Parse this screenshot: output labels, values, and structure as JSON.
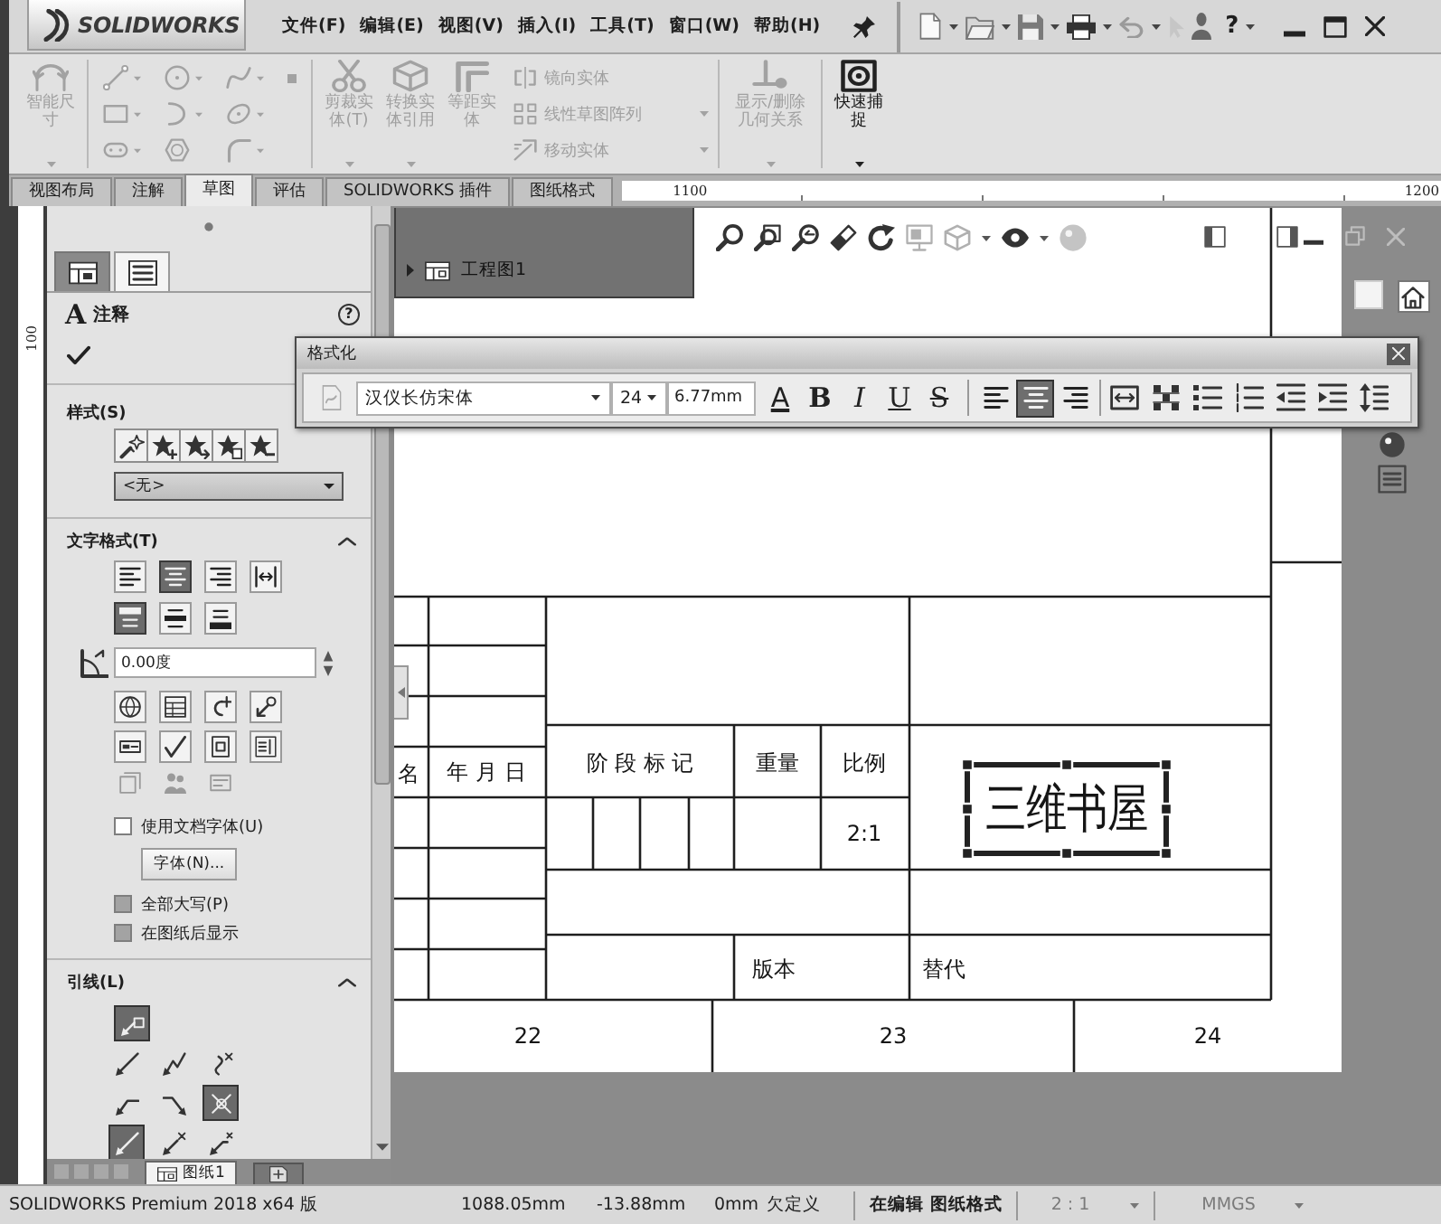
{
  "title_bar": {
    "logo": "SOLIDWORKS",
    "menus": [
      "文件(F)",
      "编辑(E)",
      "视图(V)",
      "插入(I)",
      "工具(T)",
      "窗口(W)",
      "帮助(H)"
    ],
    "help": "?"
  },
  "ribbon": {
    "groups": [
      {
        "items": [
          {
            "kind": "large",
            "label": "智能尺寸",
            "disabled": true,
            "dropdown": true
          }
        ]
      },
      {
        "items": [
          {
            "kind": "sketch_grid",
            "disabled": true
          }
        ]
      },
      {
        "items": [
          {
            "kind": "large",
            "label": "剪裁实体(T)",
            "disabled": true,
            "dropdown": true
          },
          {
            "kind": "large",
            "label": "转换实体引用",
            "disabled": true,
            "dropdown": true
          },
          {
            "kind": "large",
            "label": "等距实体",
            "disabled": true,
            "dropdown": false
          },
          {
            "kind": "stack",
            "entries": [
              {
                "label": "镜向实体",
                "disabled": true,
                "dropdown": false
              },
              {
                "label": "线性草图阵列",
                "disabled": true,
                "dropdown": true
              },
              {
                "label": "移动实体",
                "disabled": true,
                "dropdown": true
              }
            ]
          }
        ]
      },
      {
        "items": [
          {
            "kind": "large",
            "label": "显示/删除几何关系",
            "disabled": true,
            "dropdown": true
          }
        ]
      },
      {
        "items": [
          {
            "kind": "large",
            "label": "快速捕捉",
            "disabled": false,
            "dropdown": true
          }
        ]
      }
    ]
  },
  "command_tabs": [
    {
      "label": "视图布局",
      "selected": false
    },
    {
      "label": "注解",
      "selected": false
    },
    {
      "label": "草图",
      "selected": true
    },
    {
      "label": "评估",
      "selected": false
    },
    {
      "label": "SOLIDWORKS 插件",
      "selected": false
    },
    {
      "label": "图纸格式",
      "selected": false
    }
  ],
  "ruler": {
    "marks": [
      "1100",
      "1200"
    ]
  },
  "vertical_ruler": {
    "marks": [
      "100"
    ]
  },
  "property_manager": {
    "tabs": [
      {
        "selected": false
      },
      {
        "selected": true
      }
    ],
    "title_glyph": "A",
    "title": "注释",
    "help": "?",
    "sections": [
      {
        "kind": "style",
        "title": "样式(S)",
        "dropdown": "<无>"
      },
      {
        "kind": "text_format",
        "title": "文字格式(T)",
        "expanded": true,
        "align": [
          {
            "selected": false
          },
          {
            "selected": true
          },
          {
            "selected": false
          },
          {
            "selected": false
          }
        ],
        "valign": [
          {
            "selected": true
          },
          {
            "selected": false
          },
          {
            "selected": false
          }
        ],
        "angle": "0.00度",
        "use_doc_font": {
          "label": "使用文档字体(U)",
          "checked": false,
          "disabled": false
        },
        "font_button": "字体(N)...",
        "options": [
          {
            "label": "全部大写(P)",
            "checked": false,
            "disabled": true
          },
          {
            "label": "在图纸后显示",
            "checked": false,
            "disabled": true
          }
        ]
      },
      {
        "kind": "leader",
        "title": "引线(L)",
        "expanded": true,
        "rows": [
          [
            {
              "selected": true
            }
          ],
          [
            {
              "selected": false
            },
            {
              "selected": false
            },
            {
              "selected": false
            }
          ],
          [
            {
              "selected": false
            },
            {
              "selected": false
            },
            {
              "selected": true
            }
          ],
          [
            {
              "selected": true
            },
            {
              "selected": false
            },
            {
              "selected": false
            }
          ]
        ]
      }
    ],
    "sheet_tabs": [
      {
        "label": "图纸1",
        "selected": true
      }
    ]
  },
  "feature_tree": {
    "items": [
      {
        "label": "工程图1",
        "expanded": false
      }
    ]
  },
  "title_block": {
    "cut_label": "名",
    "date": "年 月 日",
    "stage_mark": "阶 段 标 记",
    "weight": "重量",
    "scale_label": "比例",
    "scale": "2:1",
    "version": "版本",
    "replaces": "替代",
    "note": {
      "text": "三维书屋",
      "selected": true
    }
  },
  "zones": [
    "22",
    "23",
    "24"
  ],
  "format_toolbar": {
    "title": "格式化",
    "font": "汉仪长仿宋体",
    "size": "24",
    "height": "6.77mm",
    "style_buttons": [
      {
        "kind": "color",
        "label": "A"
      },
      {
        "kind": "bold",
        "label": "B"
      },
      {
        "kind": "italic",
        "label": "I"
      },
      {
        "kind": "underline",
        "label": "U"
      },
      {
        "kind": "strike",
        "label": "S"
      }
    ],
    "align": [
      {
        "selected": false
      },
      {
        "selected": true
      },
      {
        "selected": false
      }
    ]
  },
  "status_bar": {
    "product": "SOLIDWORKS Premium 2018 x64 版",
    "x": "1088.05mm",
    "y": "-13.88mm",
    "z": "0mm",
    "state": "欠定义",
    "mode": "在编辑 图纸格式",
    "scale": "2 : 1",
    "units": "MMGS"
  }
}
